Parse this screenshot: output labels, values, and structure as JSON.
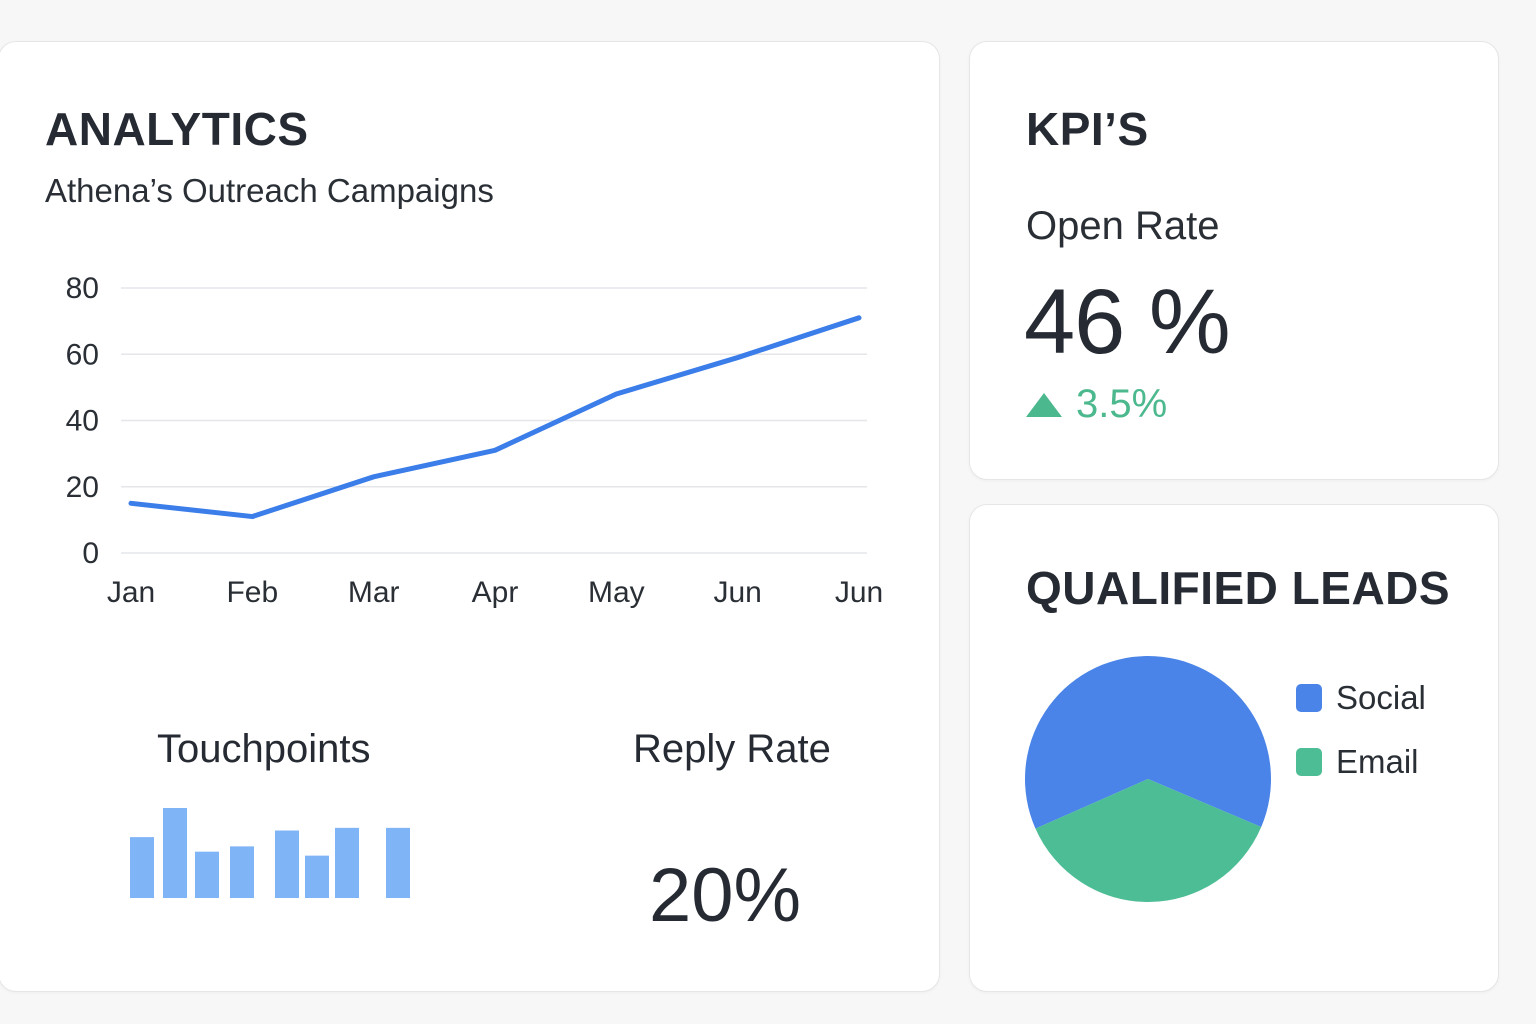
{
  "analytics": {
    "title": "ANALYTICS",
    "subtitle": "Athena’s Outreach  Campaigns",
    "touchpoints_title": "Touchpoints",
    "reply_rate_title": "Reply Rate",
    "reply_rate_value": "20%"
  },
  "kpis": {
    "title": "KPI’S",
    "open_rate_label": "Open Rate",
    "open_rate_value": "46 %",
    "open_rate_change": "3.5%",
    "change_color": "#4cb88e"
  },
  "leads": {
    "title": "QUALIFIED LEADS",
    "legend": [
      {
        "label": "Social",
        "color": "#4a84e8"
      },
      {
        "label": "Email",
        "color": "#4cbd94"
      }
    ]
  },
  "chart_data": [
    {
      "type": "line",
      "categories": [
        "Jan",
        "Feb",
        "Mar",
        "Apr",
        "May",
        "Jun",
        "Jun"
      ],
      "series": [
        {
          "values": [
            15,
            11,
            23,
            31,
            48,
            59,
            71
          ],
          "color": "#3b7de9"
        }
      ],
      "ylim": [
        0,
        80
      ],
      "yticks": [
        0,
        20,
        40,
        60,
        80
      ],
      "grid": true
    },
    {
      "type": "bar",
      "values": [
        46,
        68,
        35,
        39,
        51,
        32,
        53,
        53
      ],
      "color": "#7fb4f7",
      "ylim": [
        0,
        68
      ]
    },
    {
      "type": "pie",
      "labels": [
        "Social",
        "Email"
      ],
      "values": [
        63,
        37
      ],
      "colors": [
        "#4a84e8",
        "#4cbd94"
      ]
    }
  ]
}
